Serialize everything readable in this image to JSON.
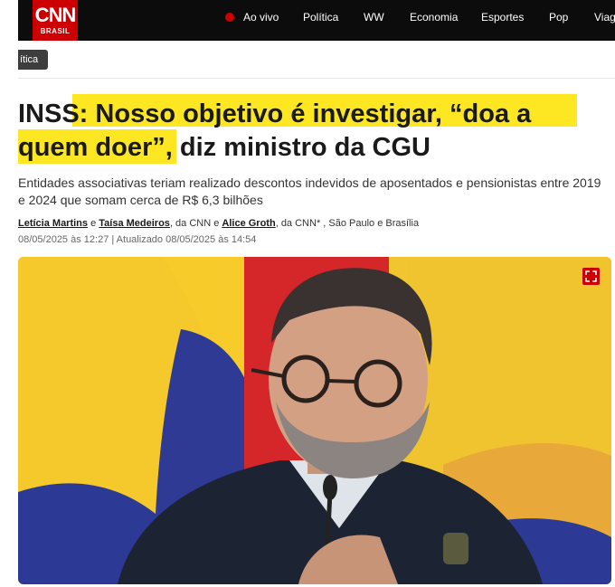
{
  "brand": {
    "logo_text": "CNN",
    "logo_sub": "BRASIL",
    "accent": "#cc0000"
  },
  "nav": {
    "items": [
      {
        "label": "Ao vivo"
      },
      {
        "label": "Política"
      },
      {
        "label": "WW"
      },
      {
        "label": "Economia"
      },
      {
        "label": "Esportes"
      },
      {
        "label": "Pop"
      },
      {
        "label": "Viage"
      }
    ]
  },
  "section_tag": "ítica",
  "article": {
    "headline_prefix": "INSS: ",
    "headline_quote_1": "Nosso objetivo é investigar, “doa a",
    "headline_quote_2": "quem doer”",
    "headline_suffix": ", diz ministro da CGU",
    "highlight_color": "#fde722",
    "subtitle": "Entidades associativas teriam realizado descontos indevidos de aposentados e pensionistas entre 2019 e 2024 que somam cerca de R$ 6,3 bilhões",
    "byline": {
      "author_1": "Letícia Martins",
      "conj_1": " e ",
      "author_2": "Taísa Medeiros",
      "org_1": ", da CNN e ",
      "author_3": "Alice Groth",
      "org_2": ", da CNN* , São Paulo e Brasília"
    },
    "dateline": "08/05/2025 às 12:27 | Atualizado 08/05/2025 às 14:54"
  },
  "hero_image": {
    "expand_icon": "fullscreen-icon"
  }
}
